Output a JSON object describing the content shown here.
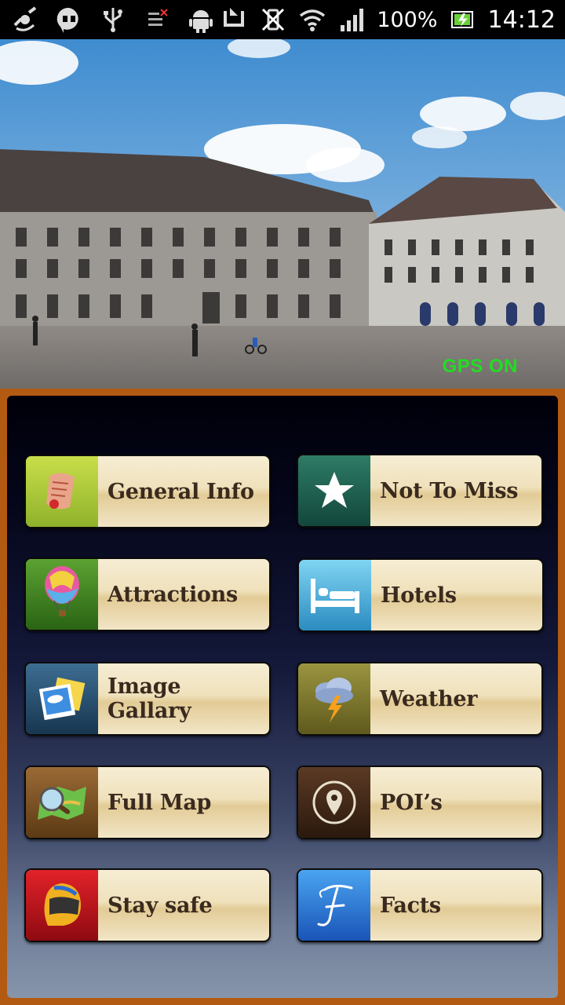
{
  "status_bar": {
    "battery": "100%",
    "time": "14:12",
    "icons": [
      "gps-icon",
      "hangouts-icon",
      "usb-icon",
      "signal-error-icon",
      "android-icon",
      "nfc-icon",
      "vibrate-off-icon",
      "wifi-icon",
      "cell-signal-icon",
      "battery-charging-icon"
    ]
  },
  "hero": {
    "gps_status": "GPS ON",
    "gps_color": "#22dd22"
  },
  "menu": {
    "items": [
      {
        "label": "General Info",
        "icon": "scroll-icon"
      },
      {
        "label": "Not To Miss",
        "icon": "star-icon"
      },
      {
        "label": "Attractions",
        "icon": "hot-air-balloon-icon"
      },
      {
        "label": "Hotels",
        "icon": "bed-icon"
      },
      {
        "label": "Image Gallary",
        "icon": "photos-icon"
      },
      {
        "label": "Weather",
        "icon": "storm-cloud-icon"
      },
      {
        "label": "Full Map",
        "icon": "map-magnifier-icon"
      },
      {
        "label": "POI’s",
        "icon": "map-pin-icon"
      },
      {
        "label": "Stay safe",
        "icon": "helmet-icon"
      },
      {
        "label": "Facts",
        "icon": "letter-f-icon"
      }
    ]
  },
  "colors": {
    "panel_border": "#b35a12",
    "button_text": "#3a2a1e"
  }
}
